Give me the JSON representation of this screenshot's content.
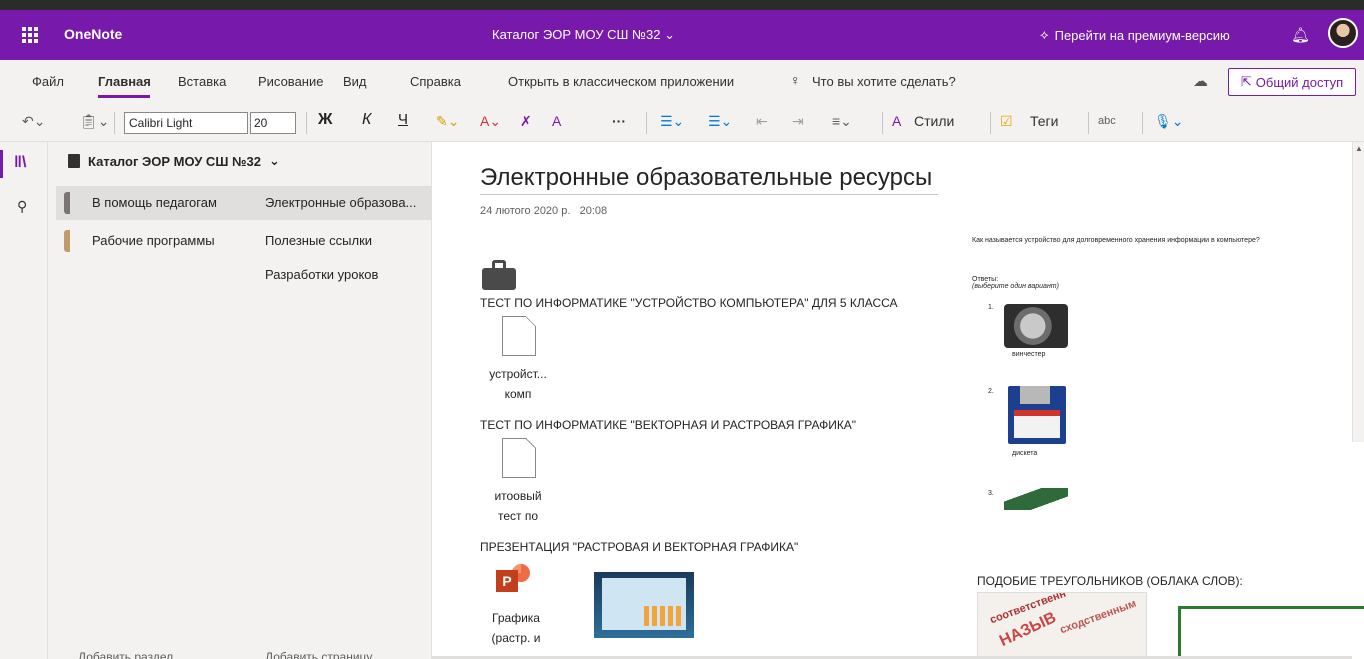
{
  "app": {
    "name": "OneNote",
    "doc_title": "Каталог ЭОР МОУ СШ №32 ⌄",
    "premium": "Перейти на премиум-версию"
  },
  "menu": {
    "items": [
      "Файл",
      "Главная",
      "Вставка",
      "Рисование",
      "Вид",
      "Справка",
      "Открыть в классическом приложении"
    ],
    "tell_me": "Что вы хотите сделать?",
    "share": "Общий доступ"
  },
  "toolbar": {
    "font_name": "Calibri Light",
    "font_size": "20",
    "bold": "Ж",
    "italic": "К",
    "underline": "Ч",
    "more": "···",
    "styles": "Стили",
    "tags": "Теги",
    "spell": "abc"
  },
  "nav": {
    "notebook": "Каталог ЭОР МОУ СШ №32",
    "sections": [
      {
        "label": "В помощь педагогам",
        "color": "#7a7574"
      },
      {
        "label": "Рабочие программы",
        "color": "#c19c6b"
      }
    ],
    "pages": [
      "Электронные образова...",
      "Полезные ссылки",
      "Разработки уроков"
    ],
    "add_section": "Добавить раздел",
    "add_page": "Добавить страницу"
  },
  "page": {
    "title": "Электронные образовательные ресурсы",
    "date": "24 лютого 2020 р.",
    "time": "20:08",
    "items": [
      {
        "heading": "ТЕСТ ПО ИНФОРМАТИКЕ \"УСТРОЙСТВО КОМПЬЮТЕРА\" ДЛЯ 5 КЛАССА",
        "file_line1": "устройст...",
        "file_line2": "комп"
      },
      {
        "heading": "ТЕСТ ПО ИНФОРМАТИКЕ \"ВЕКТОРНАЯ И РАСТРОВАЯ ГРАФИКА\"",
        "file_line1": "итоовый",
        "file_line2": "тест по"
      },
      {
        "heading": "ПРЕЗЕНТАЦИЯ \"РАСТРОВАЯ И ВЕКТОРНАЯ ГРАФИКА\"",
        "file_line1": "Графика",
        "file_line2": "(растр. и"
      }
    ],
    "quiz": {
      "question": "Как называется устройство для долговременного хранения информации в компьютере?",
      "answers_label": "Ответы:",
      "hint": "(выберите один вариант)",
      "options": [
        {
          "num": "1.",
          "caption": "винчестер"
        },
        {
          "num": "2.",
          "caption": "дискета"
        },
        {
          "num": "3.",
          "caption": ""
        }
      ]
    },
    "cloud_title": "ПОДОБИЕ ТРЕУГОЛЬНИКОВ (ОБЛАКА СЛОВ):"
  }
}
